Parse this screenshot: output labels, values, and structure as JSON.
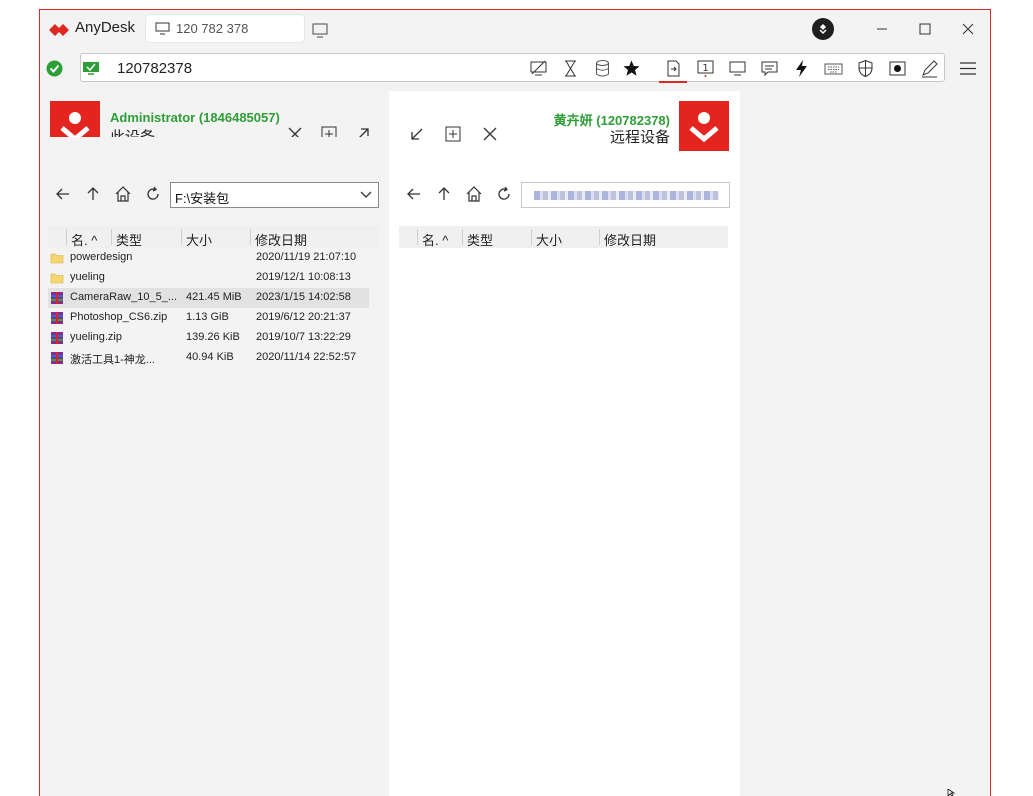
{
  "app": {
    "name": "AnyDesk",
    "tab_label": "120 782 378"
  },
  "address": {
    "value": "120782378"
  },
  "toolbar_icons": [
    "privacy-icon",
    "hourglass-icon",
    "database-icon",
    "star-icon",
    "file-transfer-icon",
    "monitor-one-icon",
    "display-icon",
    "chat-icon",
    "lightning-icon",
    "keyboard-icon",
    "shield-icon",
    "record-icon",
    "pen-icon"
  ],
  "local": {
    "user": "Administrator (1846485057)",
    "label": "此设备",
    "path": "F:\\安装包",
    "headers": {
      "name": "名. ^",
      "type": "类型",
      "size": "大小",
      "date": "修改日期"
    },
    "files": [
      {
        "icon": "folder-icon",
        "name": "powerdesign",
        "size": "",
        "date": "2020/11/19 21:07:10",
        "selected": false
      },
      {
        "icon": "folder-icon",
        "name": "yueling",
        "size": "",
        "date": "2019/12/1 10:08:13",
        "selected": false
      },
      {
        "icon": "archive-icon",
        "name": "CameraRaw_10_5_...",
        "size": "421.45 MiB",
        "date": "2023/1/15 14:02:58",
        "selected": true
      },
      {
        "icon": "archive-icon",
        "name": "Photoshop_CS6.zip",
        "size": "1.13 GiB",
        "date": "2019/6/12 20:21:37",
        "selected": false
      },
      {
        "icon": "archive-icon",
        "name": "yueling.zip",
        "size": "139.26 KiB",
        "date": "2019/10/7 13:22:29",
        "selected": false
      },
      {
        "icon": "archive-icon",
        "name": "激活工具1-神龙...",
        "size": "40.94 KiB",
        "date": "2020/11/14 22:52:57",
        "selected": false
      }
    ]
  },
  "remote": {
    "user": "黄卉妍 (120782378)",
    "label": "远程设备",
    "headers": {
      "name": "名. ^",
      "type": "类型",
      "size": "大小",
      "date": "修改日期"
    }
  },
  "colors": {
    "accent": "#d92a23",
    "green": "#2e9e37",
    "badge": "#e4251f"
  }
}
